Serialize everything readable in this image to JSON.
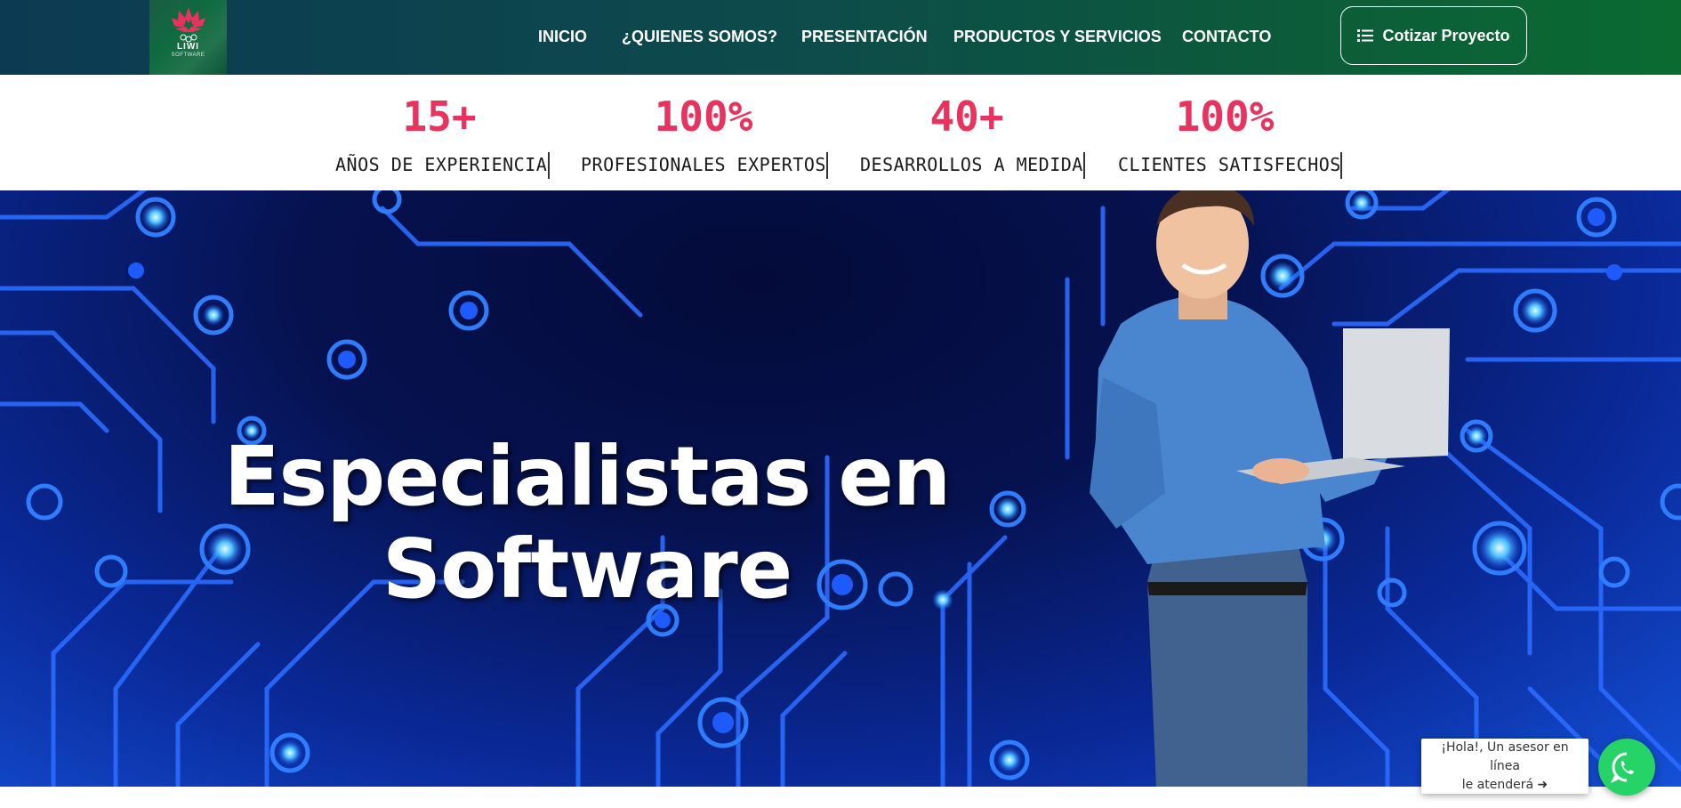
{
  "header": {
    "logo": {
      "word": "LIWI",
      "sub": "SOFTWARE"
    },
    "nav": [
      {
        "label": "INICIO"
      },
      {
        "label": "¿QUIENES SOMOS?"
      },
      {
        "label": "PRESENTACIÓN"
      },
      {
        "label": "PRODUCTOS Y SERVICIOS"
      },
      {
        "label": "CONTACTO"
      }
    ],
    "cta": {
      "label": "Cotizar Proyecto",
      "icon": "list-icon"
    }
  },
  "stats": [
    {
      "value": "15+",
      "label": "AÑOS DE EXPERIENCIA"
    },
    {
      "value": "100%",
      "label": "PROFESIONALES EXPERTOS"
    },
    {
      "value": "40+",
      "label": "DESARROLLOS A MEDIDA"
    },
    {
      "value": "100%",
      "label": "CLIENTES SATISFECHOS"
    }
  ],
  "hero": {
    "title_line1": "Especialistas en",
    "title_line2": "Software"
  },
  "chat": {
    "text": "¡Hola!, Un asesor en línea\nle atenderá ➜",
    "icon": "whatsapp-icon"
  },
  "colors": {
    "accent": "#e8335f",
    "header_start": "#0c3a52",
    "header_end": "#0a6b31",
    "whatsapp": "#25d366"
  }
}
